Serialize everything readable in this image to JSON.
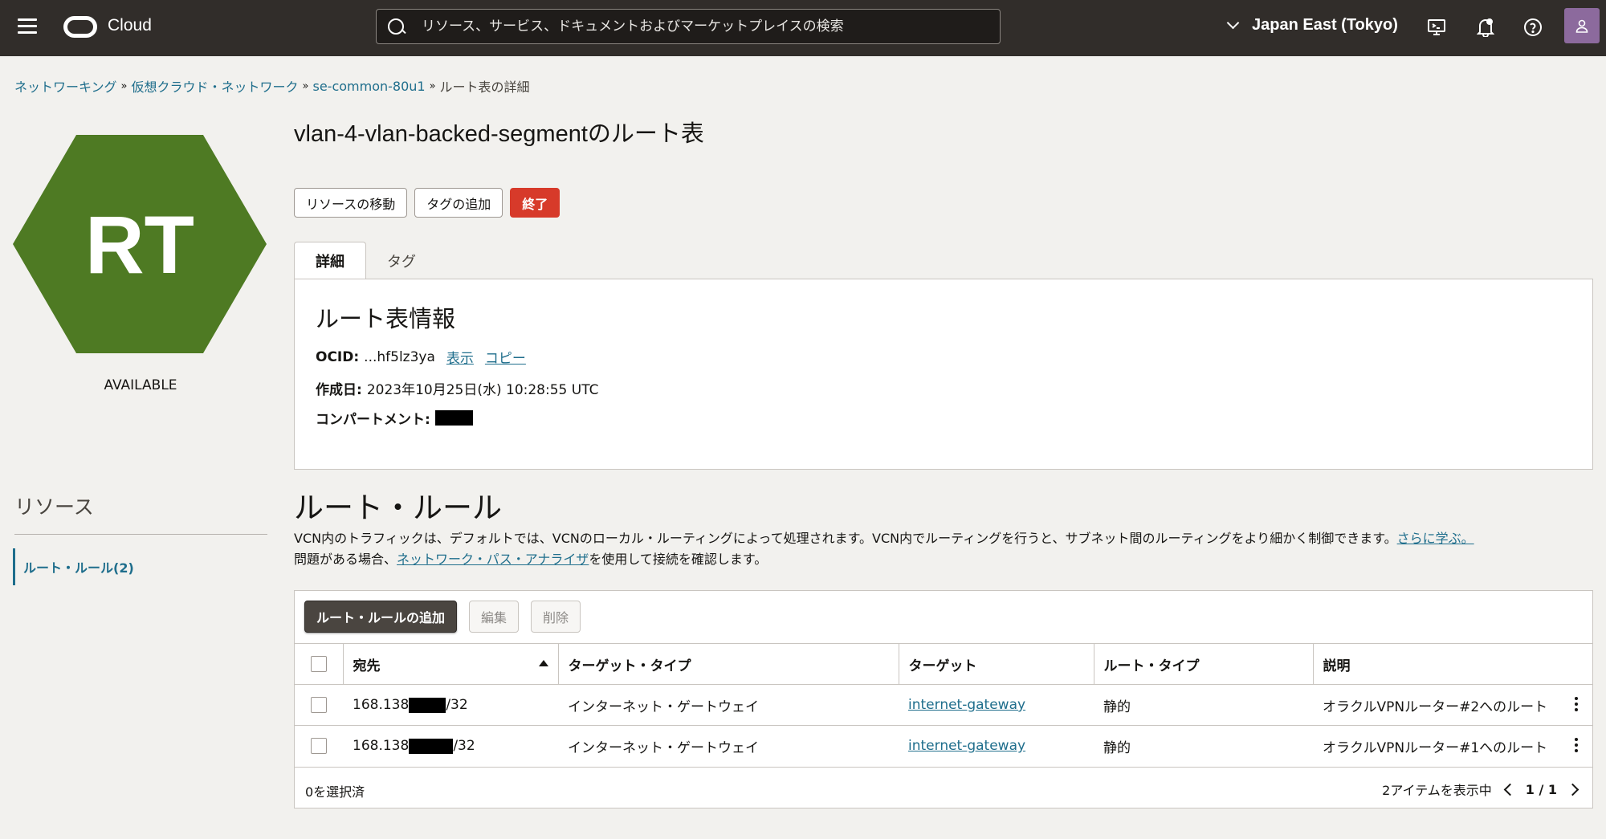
{
  "topbar": {
    "brand": "Cloud",
    "search_placeholder": "リソース、サービス、ドキュメントおよびマーケットプレイスの検索",
    "region": "Japan East (Tokyo)"
  },
  "breadcrumb": {
    "items": [
      "ネットワーキング",
      "仮想クラウド・ネットワーク",
      "se-common-80u1"
    ],
    "separator": "»",
    "current": "ルート表の詳細"
  },
  "resource_icon": {
    "initials": "RT",
    "color": "#4e7a23",
    "status": "AVAILABLE"
  },
  "page_title": "vlan-4-vlan-backed-segmentのルート表",
  "actions": {
    "move": "リソースの移動",
    "add_tags": "タグの追加",
    "terminate": "終了"
  },
  "tabs": [
    "詳細",
    "タグ"
  ],
  "info": {
    "title": "ルート表情報",
    "ocid_label": "OCID:",
    "ocid_value": "...hf5lz3ya",
    "show": "表示",
    "copy": "コピー",
    "created_label": "作成日:",
    "created_value": "2023年10月25日(水) 10:28:55 UTC",
    "compartment_label": "コンパートメント:"
  },
  "resources": {
    "title": "リソース",
    "item": "ルート・ルール(2)"
  },
  "route_rules": {
    "title": "ルート・ルール",
    "desc_line1": "VCN内のトラフィックは、デフォルトでは、VCNのローカル・ルーティングによって処理されます。VCN内でルーティングを行うと、サブネット間のルーティングをより細かく制御できます。",
    "learn_more": "さらに学ぶ。",
    "desc_line2_pre": "問題がある場合、",
    "analyzer_link": "ネットワーク・パス・アナライザ",
    "desc_line2_post": "を使用して接続を確認します。",
    "add_button": "ルート・ルールの追加",
    "edit_button": "編集",
    "delete_button": "削除",
    "columns": [
      "宛先",
      "ターゲット・タイプ",
      "ターゲット",
      "ルート・タイプ",
      "説明"
    ],
    "rows": [
      {
        "dest_prefix": "168.138",
        "dest_suffix": "/32",
        "target_type": "インターネット・ゲートウェイ",
        "target": "internet-gateway",
        "route_type": "静的",
        "description": "オラクルVPNルーター#2へのルート"
      },
      {
        "dest_prefix": "168.138",
        "dest_suffix": "/32",
        "target_type": "インターネット・ゲートウェイ",
        "target": "internet-gateway",
        "route_type": "静的",
        "description": "オラクルVPNルーター#1へのルート"
      }
    ],
    "selected": "0を選択済",
    "showing": "2アイテムを表示中",
    "page": "1 / 1"
  }
}
